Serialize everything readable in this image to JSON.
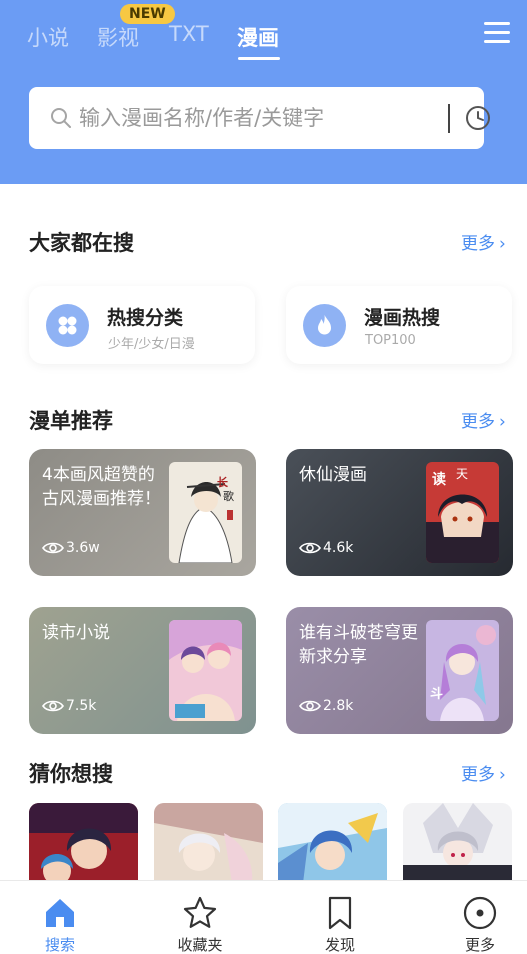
{
  "header": {
    "tabs": [
      {
        "label": "小说",
        "active": false
      },
      {
        "label": "影视",
        "active": false
      },
      {
        "label": "TXT",
        "active": false
      },
      {
        "label": "漫画",
        "active": true
      }
    ],
    "new_badge": "NEW",
    "accent_color": "#6b9cf4"
  },
  "search": {
    "placeholder": "输入漫画名称/作者/关键字",
    "value": ""
  },
  "popular": {
    "title": "大家都在搜",
    "more": "更多",
    "cards": [
      {
        "title": "热搜分类",
        "sub": "少年/少女/日漫",
        "icon": "grid-icon"
      },
      {
        "title": "漫画热搜",
        "sub": "TOP100",
        "icon": "flame-icon"
      }
    ]
  },
  "recommend": {
    "title": "漫单推荐",
    "more": "更多",
    "cards": [
      {
        "title": "4本画风超赞的古风漫画推荐！",
        "views": "3.6w"
      },
      {
        "title": "休仙漫画",
        "views": "4.6k"
      },
      {
        "title": "读市小说",
        "views": "7.5k"
      },
      {
        "title": "谁有斗破苍穹更新求分享",
        "views": "2.8k"
      }
    ]
  },
  "guess": {
    "title": "猜你想搜",
    "more": "更多"
  },
  "bottom_nav": [
    {
      "label": "搜索",
      "icon": "home-icon",
      "active": true
    },
    {
      "label": "收藏夹",
      "icon": "star-icon",
      "active": false
    },
    {
      "label": "发现",
      "icon": "bookmark-icon",
      "active": false
    },
    {
      "label": "更多",
      "icon": "more-circle-icon",
      "active": false
    }
  ]
}
